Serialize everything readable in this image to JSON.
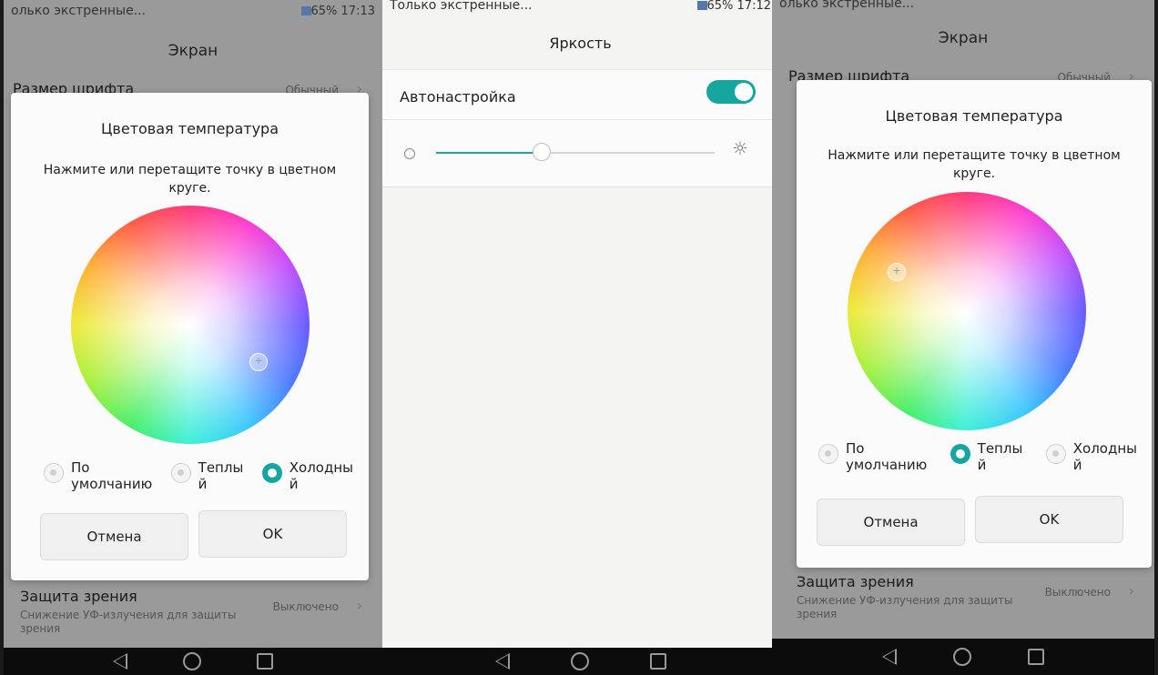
{
  "colors": {
    "accent": "#16a6a0",
    "dialog_bg": "#fbfbfb"
  },
  "left": {
    "status": {
      "text": "олько экстренные...",
      "right": "65%  17:13"
    },
    "title": "Экран",
    "font_row": {
      "title": "Размер шрифта",
      "value": "Обычный"
    },
    "dialog": {
      "title": "Цветовая температура",
      "message": "Нажмите или перетащите точку в цветном круге.",
      "options": [
        {
          "label": "По\nумолчанию",
          "selected": false
        },
        {
          "label": "Теплы\nй",
          "selected": false
        },
        {
          "label": "Холодны\nй",
          "selected": true
        }
      ],
      "cancel": "Отмена",
      "ok": "OK"
    },
    "eye_row": {
      "title": "Защита зрения",
      "subtitle": "Снижение УФ-излучения для защиты зрения",
      "value": "Выключено"
    }
  },
  "middle": {
    "status": {
      "text": "Только экстренные...",
      "right": "65%  17:12"
    },
    "title": "Яркость",
    "auto": {
      "label": "Автонастройка",
      "enabled": true
    },
    "brightness_level": 0.38
  },
  "right": {
    "status": {
      "text": "олько экстренные...",
      "right": ""
    },
    "title": "Экран",
    "font_row": {
      "title": "Размер шрифта",
      "value": "Обычный"
    },
    "dialog": {
      "title": "Цветовая температура",
      "message": "Нажмите или перетащите точку в цветном круге.",
      "options": [
        {
          "label": "По\nумолчанию",
          "selected": false
        },
        {
          "label": "Теплы\nй",
          "selected": true
        },
        {
          "label": "Холодны\nй",
          "selected": false
        }
      ],
      "cancel": "Отмена",
      "ok": "OK"
    },
    "eye_row": {
      "title": "Защита зрения",
      "subtitle": "Снижение УФ-излучения для защиты зрения",
      "value": "Выключено"
    }
  }
}
